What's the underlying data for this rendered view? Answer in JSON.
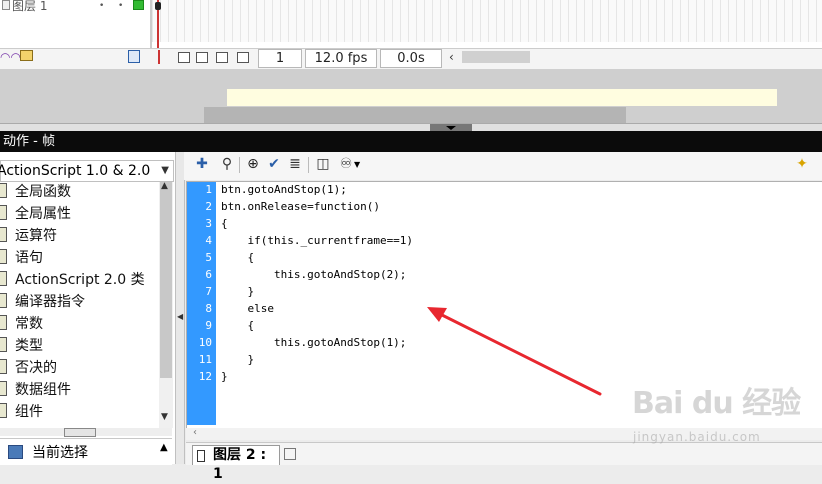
{
  "timeline": {
    "layer_name": "图层 1",
    "frame_number": "1",
    "fps": "12.0 fps",
    "elapsed": "0.0s"
  },
  "panel": {
    "title": "动作 - 帧"
  },
  "actions_toolbox": {
    "version_select": "ActionScript 1.0 & 2.0",
    "categories": [
      "全局函数",
      "全局属性",
      "运算符",
      "语句",
      "ActionScript 2.0 类",
      "编译器指令",
      "常数",
      "类型",
      "否决的",
      "数据组件",
      "组件"
    ],
    "current_selection": "当前选择"
  },
  "editor": {
    "line_numbers": [
      "1",
      "2",
      "3",
      "4",
      "5",
      "6",
      "7",
      "8",
      "9",
      "10",
      "11",
      "12"
    ],
    "lines": [
      "btn.gotoAndStop(1);",
      "btn.onRelease=function()",
      "{",
      "    if(this._currentframe==1)",
      "    {",
      "        this.gotoAndStop(2);",
      "    }",
      "    else",
      "    {",
      "        this.gotoAndStop(1);",
      "    }",
      "}"
    ],
    "tab_label": "图层 2 : 1"
  },
  "watermark": {
    "logo": "Bai du 经验",
    "sub": "jingyan.baidu.com"
  },
  "colors": {
    "gutter": "#3399ff",
    "panel_title_bg": "#0b0b0b",
    "annotation_arrow": "#e8272f"
  }
}
